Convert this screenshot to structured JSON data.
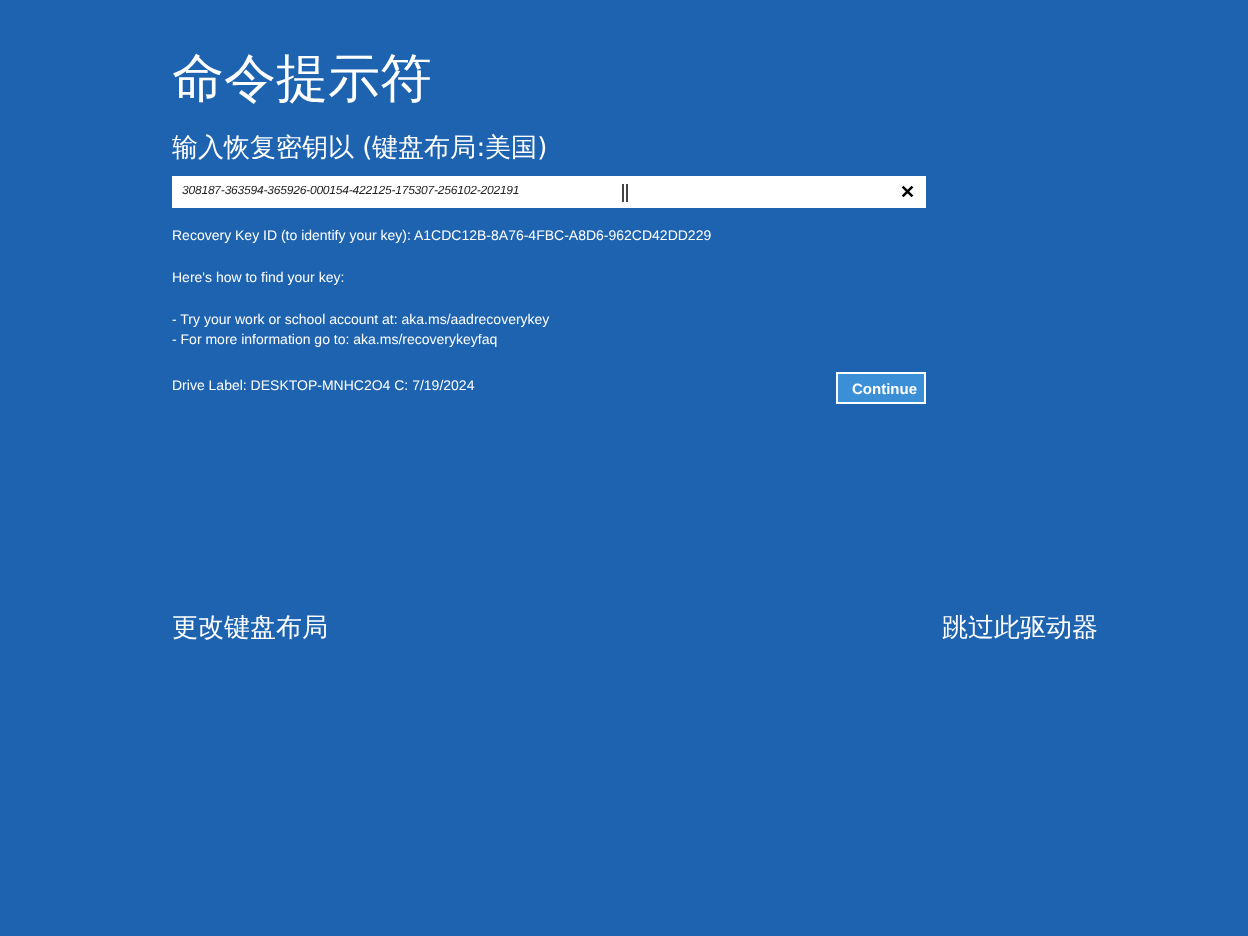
{
  "title": "命令提示符",
  "prompt": "输入恢复密钥以 (键盘布局:美国)",
  "key_field": {
    "value": "308187-363594-365926-000154-422125-175307-256102-202191",
    "clear": "✕"
  },
  "info": [
    "Recovery Key ID (to identify your key): A1CDC12B-8A76-4FBC-A8D6-962CD42DD229",
    "Here's how to find your key:",
    "- Try your work or school account at: aka.ms/aadrecoverykey\n- For more information go to: aka.ms/recoverykeyfaq"
  ],
  "drive_label": "Drive Label: DESKTOP-MNHC2O4 C: 7/19/2024",
  "continue_button": "Continue",
  "links": [
    "更改键盘布局",
    "跳过此驱动器"
  ]
}
